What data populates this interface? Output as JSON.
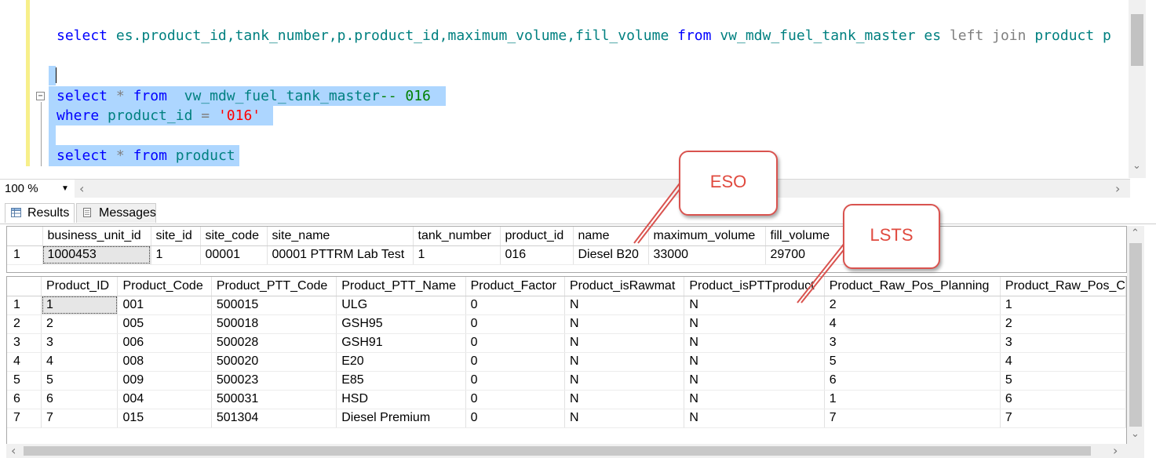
{
  "editor": {
    "line1": {
      "kw_select": "select",
      "cols": "es.product_id,tank_number,p.product_id,maximum_volume,fill_volume",
      "kw_from": "from",
      "table": "vw_mdw_fuel_tank_master",
      "alias": "es",
      "join": "left join",
      "product": "product p"
    },
    "line3": {
      "kw_select": "select",
      "star": "*",
      "kw_from": "from",
      "table": "vw_mdw_fuel_tank_master",
      "comment": "-- 016"
    },
    "line4": {
      "kw_where": "where",
      "col": "product_id",
      "op": "=",
      "value": "'016'"
    },
    "line6": {
      "kw_select": "select",
      "star": "*",
      "kw_from": "from",
      "table": "product"
    }
  },
  "zoom": {
    "value": "100 %"
  },
  "tabs": {
    "results": "Results",
    "messages": "Messages"
  },
  "grid1": {
    "headers": [
      "business_unit_id",
      "site_id",
      "site_code",
      "site_name",
      "tank_number",
      "product_id",
      "name",
      "maximum_volume",
      "fill_volume"
    ],
    "rows": [
      {
        "rn": "1",
        "cells": [
          "1000453",
          "1",
          "00001",
          "00001 PTTRM Lab Test",
          "1",
          "016",
          "Diesel B20",
          "33000",
          "29700"
        ]
      }
    ]
  },
  "grid2": {
    "headers": [
      "Product_ID",
      "Product_Code",
      "Product_PTT_Code",
      "Product_PTT_Name",
      "Product_Factor",
      "Product_isRawmat",
      "Product_isPTTproduct",
      "Product_Raw_Pos_Planning",
      "Product_Raw_Pos_C"
    ],
    "rows": [
      {
        "rn": "1",
        "cells": [
          "1",
          "001",
          "500015",
          "ULG",
          "0",
          "N",
          "N",
          "2",
          "1"
        ]
      },
      {
        "rn": "2",
        "cells": [
          "2",
          "005",
          "500018",
          "GSH95",
          "0",
          "N",
          "N",
          "4",
          "2"
        ]
      },
      {
        "rn": "3",
        "cells": [
          "3",
          "006",
          "500028",
          "GSH91",
          "0",
          "N",
          "N",
          "3",
          "3"
        ]
      },
      {
        "rn": "4",
        "cells": [
          "4",
          "008",
          "500020",
          "E20",
          "0",
          "N",
          "N",
          "5",
          "4"
        ]
      },
      {
        "rn": "5",
        "cells": [
          "5",
          "009",
          "500023",
          "E85",
          "0",
          "N",
          "N",
          "6",
          "5"
        ]
      },
      {
        "rn": "6",
        "cells": [
          "6",
          "004",
          "500031",
          "HSD",
          "0",
          "N",
          "N",
          "1",
          "6"
        ]
      },
      {
        "rn": "7",
        "cells": [
          "7",
          "015",
          "501304",
          "Diesel Premium",
          "0",
          "N",
          "N",
          "7",
          "7"
        ]
      }
    ]
  },
  "callouts": {
    "eso": "ESO",
    "lsts": "LSTS"
  },
  "colors": {
    "keyword": "#0000ff",
    "identifier": "#008080",
    "comment": "#008000",
    "string": "#ff0000",
    "selection": "#add6ff",
    "callout": "#d9534f"
  }
}
